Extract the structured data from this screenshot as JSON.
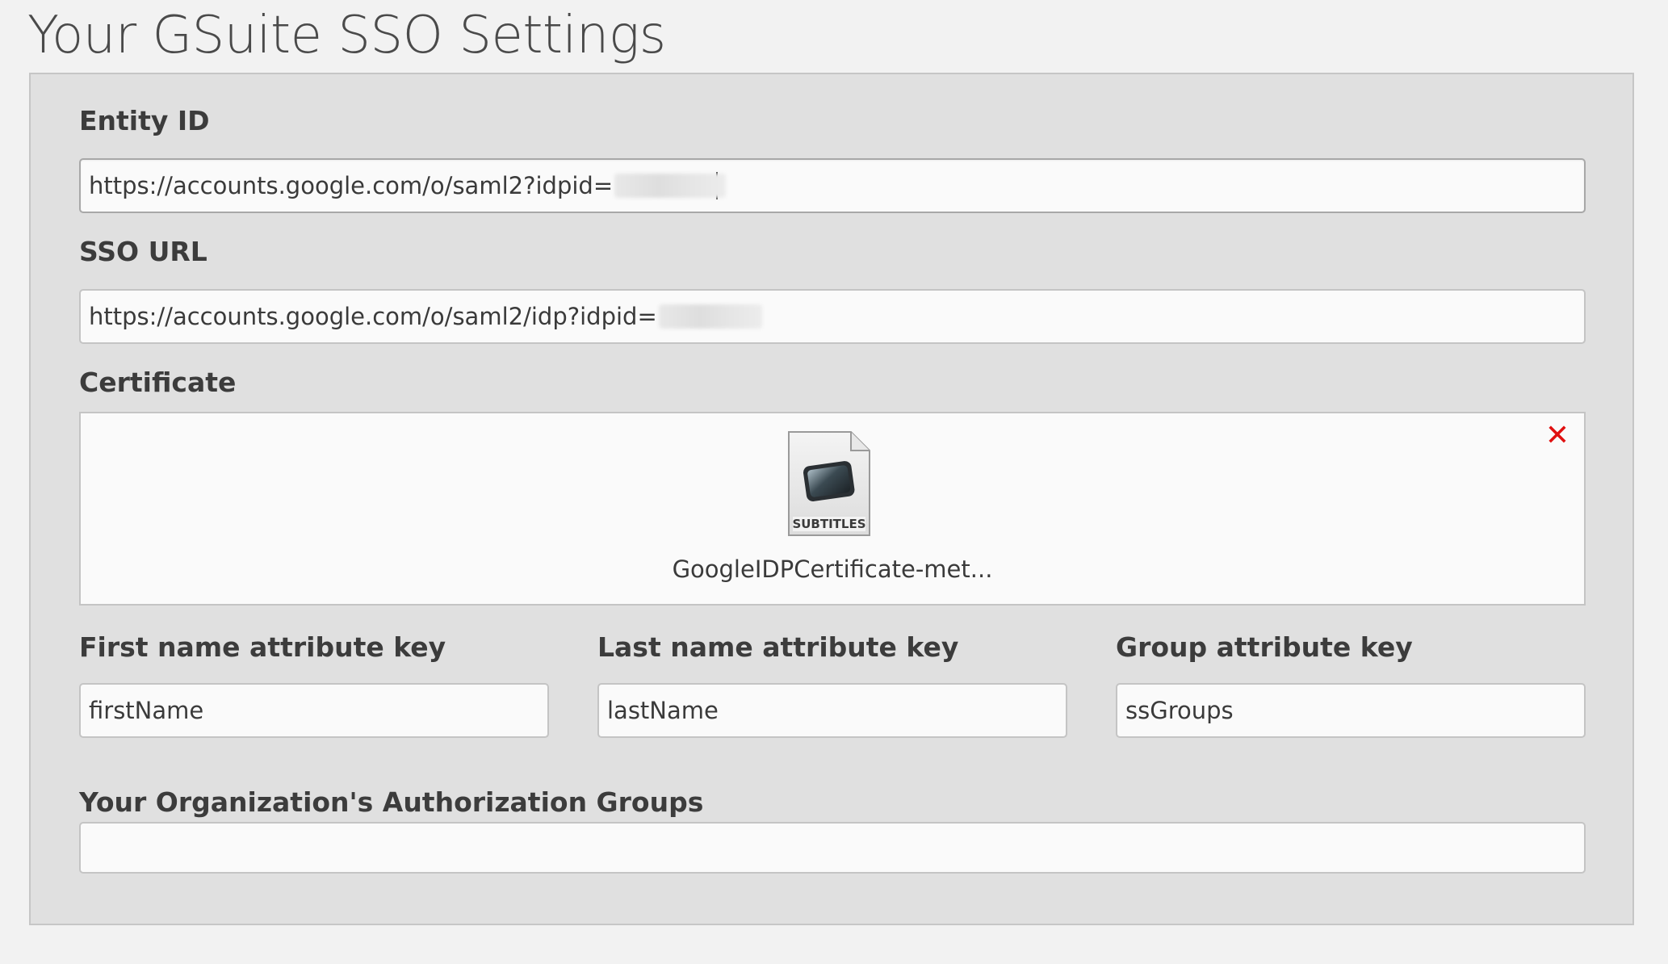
{
  "page": {
    "title": "Your GSuite SSO Settings"
  },
  "fields": {
    "entity_id": {
      "label": "Entity ID",
      "value": "https://accounts.google.com/o/saml2?idpid="
    },
    "sso_url": {
      "label": "SSO URL",
      "value": "https://accounts.google.com/o/saml2/idp?idpid="
    },
    "certificate": {
      "label": "Certificate",
      "file_name": "GoogleIDPCertificate-met...",
      "icon_label": "SUBTITLES",
      "remove_symbol": "✕"
    },
    "first_name": {
      "label": "First name attribute key",
      "value": "firstName"
    },
    "last_name": {
      "label": "Last name attribute key",
      "value": "lastName"
    },
    "group": {
      "label": "Group attribute key",
      "value": "ssGroups"
    },
    "auth_groups": {
      "label": "Your Organization's Authorization Groups",
      "value": ""
    }
  },
  "colors": {
    "remove": "#e01010",
    "panel": "#e0e0e0",
    "background": "#f2f2f2"
  }
}
